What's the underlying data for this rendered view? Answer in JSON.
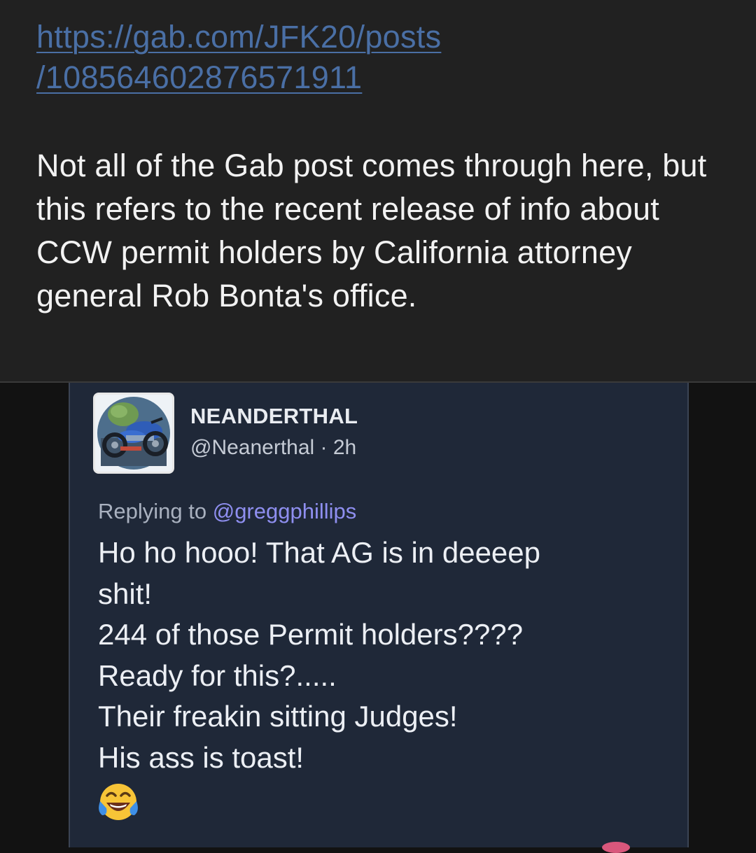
{
  "message": {
    "link_line1": "https://gab.com/JFK20/posts",
    "link_line2": "/108564602876571911",
    "body": "Not all of the Gab post comes through here, but this refers to the recent release of info about CCW permit holders by California attorney general Rob Bonta's office."
  },
  "embedded_post": {
    "author_name": "NEANDERTHAL",
    "author_handle": "@Neanerthal · 2h",
    "replying_prefix": "Replying to ",
    "replying_handle": "@greggphillips",
    "lines": [
      "Ho ho hooo! That AG is in deeeep",
      "shit!",
      "244 of those Permit holders????",
      "Ready for this?.....",
      "Their freakin sitting Judges!",
      "His ass is toast!"
    ],
    "emoji": "tears-of-joy-emoji"
  },
  "colors": {
    "link": "#4a6fa5",
    "message_bg": "#212121",
    "post_bg": "#1f2838",
    "mention": "#8f8ff0"
  }
}
